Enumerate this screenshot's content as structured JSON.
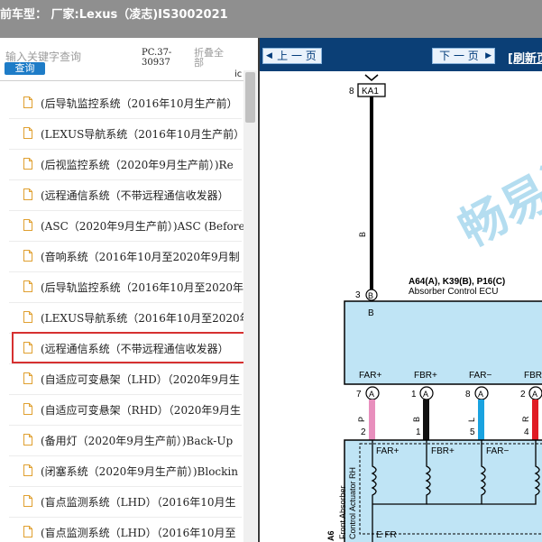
{
  "window": {
    "title": "前车型： 厂家:Lexus（凌志)IS3002021"
  },
  "sidebar": {
    "search_placeholder": "输入关键字查询",
    "search_button": "查询",
    "pc_code": "PC.37-30937",
    "fold_all": "折叠全部",
    "col_hint": "ic",
    "items": [
      {
        "label": "(后导轨监控系统（2016年10月生产前）"
      },
      {
        "label": "(LEXUS导航系统（2016年10月生产前）"
      },
      {
        "label": "(后视监控系统（2020年9月生产前）)Re"
      },
      {
        "label": "(远程通信系统（不带远程通信收发器）"
      },
      {
        "label": "(ASC（2020年9月生产前）)ASC (Before"
      },
      {
        "label": "(音响系统（2016年10月至2020年9月制"
      },
      {
        "label": "(后导轨监控系统（2016年10月至2020年"
      },
      {
        "label": "(LEXUS导航系统（2016年10月至2020年"
      },
      {
        "label": "(远程通信系统（不带远程通信收发器）"
      },
      {
        "label": "(自适应可变悬架（LHD）（2020年9月生"
      },
      {
        "label": "(自适应可变悬架（RHD）（2020年9月生"
      },
      {
        "label": "(备用灯（2020年9月生产前）)Back-Up"
      },
      {
        "label": "(闭塞系统（2020年9月生产前）)Blockin"
      },
      {
        "label": "(盲点监测系统（LHD）（2016年10月生"
      },
      {
        "label": "(盲点监测系统（LHD）（2016年10月至"
      }
    ]
  },
  "viewer": {
    "prev_label": "上 一 页",
    "next_label": "下 一 页",
    "refresh_label": "[刷新页",
    "watermark": "畅易汽",
    "colors": {
      "pink": "#e88fbd",
      "blue": "#1aa3e0",
      "red": "#e01b24",
      "box": "#bfe4f5"
    },
    "connector": {
      "pin": "8",
      "name": "KA1"
    },
    "wire_b": "B",
    "ecu": {
      "connectors": "A64(A), K39(B), P16(C)",
      "name": "Absorber Control ECU",
      "pin": "3",
      "conn": "B",
      "b_label": "B"
    },
    "terminals": [
      {
        "name": "FAR+",
        "pin": "7",
        "conn": "A",
        "color_code": "P",
        "far_pin": "2"
      },
      {
        "name": "FBR+",
        "pin": "1",
        "conn": "A",
        "color_code": "B",
        "far_pin": "1"
      },
      {
        "name": "FAR−",
        "pin": "8",
        "conn": "A",
        "color_code": "L",
        "far_pin": "5"
      },
      {
        "name": "FBR",
        "pin": "2",
        "conn": "A",
        "color_code": "R",
        "far_pin": "4"
      }
    ],
    "actuator": {
      "label_line1": "Front Absorber",
      "label_line2": "Control Actuator RH",
      "code": "A6",
      "terms": [
        "FAR+",
        "FBR+",
        "FAR−"
      ],
      "ground": "E FR"
    }
  }
}
